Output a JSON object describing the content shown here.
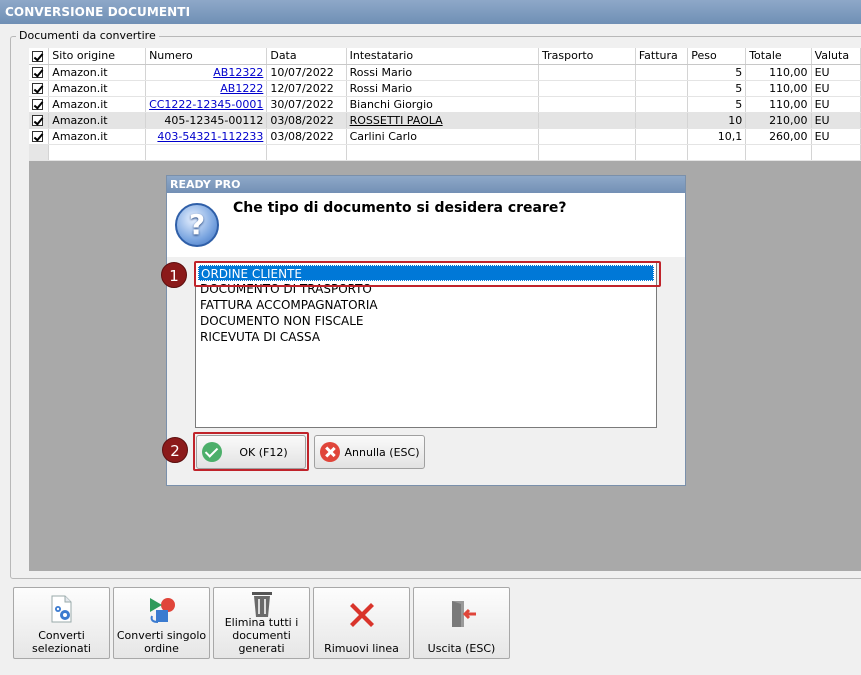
{
  "window": {
    "title": "CONVERSIONE DOCUMENTI"
  },
  "group": {
    "label": "Documenti da convertire"
  },
  "table": {
    "columns": [
      "Sito origine",
      "Numero",
      "Data",
      "Intestatario",
      "Trasporto",
      "Fattura",
      "Peso",
      "Totale",
      "Valuta"
    ],
    "rows": [
      {
        "checked": true,
        "site": "Amazon.it",
        "numero": "AB12322",
        "data": "10/07/2022",
        "intestatario": "Rossi Mario",
        "trasporto": "",
        "fattura": "",
        "peso": "5",
        "totale": "110,00",
        "valuta": "EU"
      },
      {
        "checked": true,
        "site": "Amazon.it",
        "numero": "AB1222",
        "data": "12/07/2022",
        "intestatario": "Rossi Mario",
        "trasporto": "",
        "fattura": "",
        "peso": "5",
        "totale": "110,00",
        "valuta": "EU"
      },
      {
        "checked": true,
        "site": "Amazon.it",
        "numero": "CC1222-12345-0001",
        "data": "30/07/2022",
        "intestatario": "Bianchi Giorgio",
        "trasporto": "",
        "fattura": "",
        "peso": "5",
        "totale": "110,00",
        "valuta": "EU"
      },
      {
        "checked": true,
        "site": "Amazon.it",
        "numero": "405-12345-00112",
        "data": "03/08/2022",
        "intestatario": "ROSSETTI PAOLA",
        "trasporto": "",
        "fattura": "",
        "peso": "10",
        "totale": "210,00",
        "valuta": "EU"
      },
      {
        "checked": true,
        "site": "Amazon.it",
        "numero": "403-54321-112233",
        "data": "03/08/2022",
        "intestatario": "Carlini Carlo",
        "trasporto": "",
        "fattura": "",
        "peso": "10,1",
        "totale": "260,00",
        "valuta": "EU"
      }
    ]
  },
  "dialog": {
    "title": "READY PRO",
    "question": "Che tipo di documento si desidera creare?",
    "options": [
      "ORDINE CLIENTE",
      "DOCUMENTO DI TRASPORTO",
      "FATTURA ACCOMPAGNATORIA",
      "DOCUMENTO NON FISCALE",
      "RICEVUTA DI CASSA"
    ],
    "selected_index": 0,
    "ok_label": "OK (F12)",
    "cancel_label": "Annulla (ESC)",
    "badges": [
      "1",
      "2"
    ]
  },
  "toolbar": {
    "buttons": [
      "Converti selezionati",
      "Converti singolo ordine",
      "Elimina tutti i documenti generati",
      "Rimuovi linea",
      "Uscita (ESC)"
    ]
  },
  "colors": {
    "accent": "#0078d7",
    "highlight": "#c0232a",
    "badge": "#8b1a1a"
  }
}
